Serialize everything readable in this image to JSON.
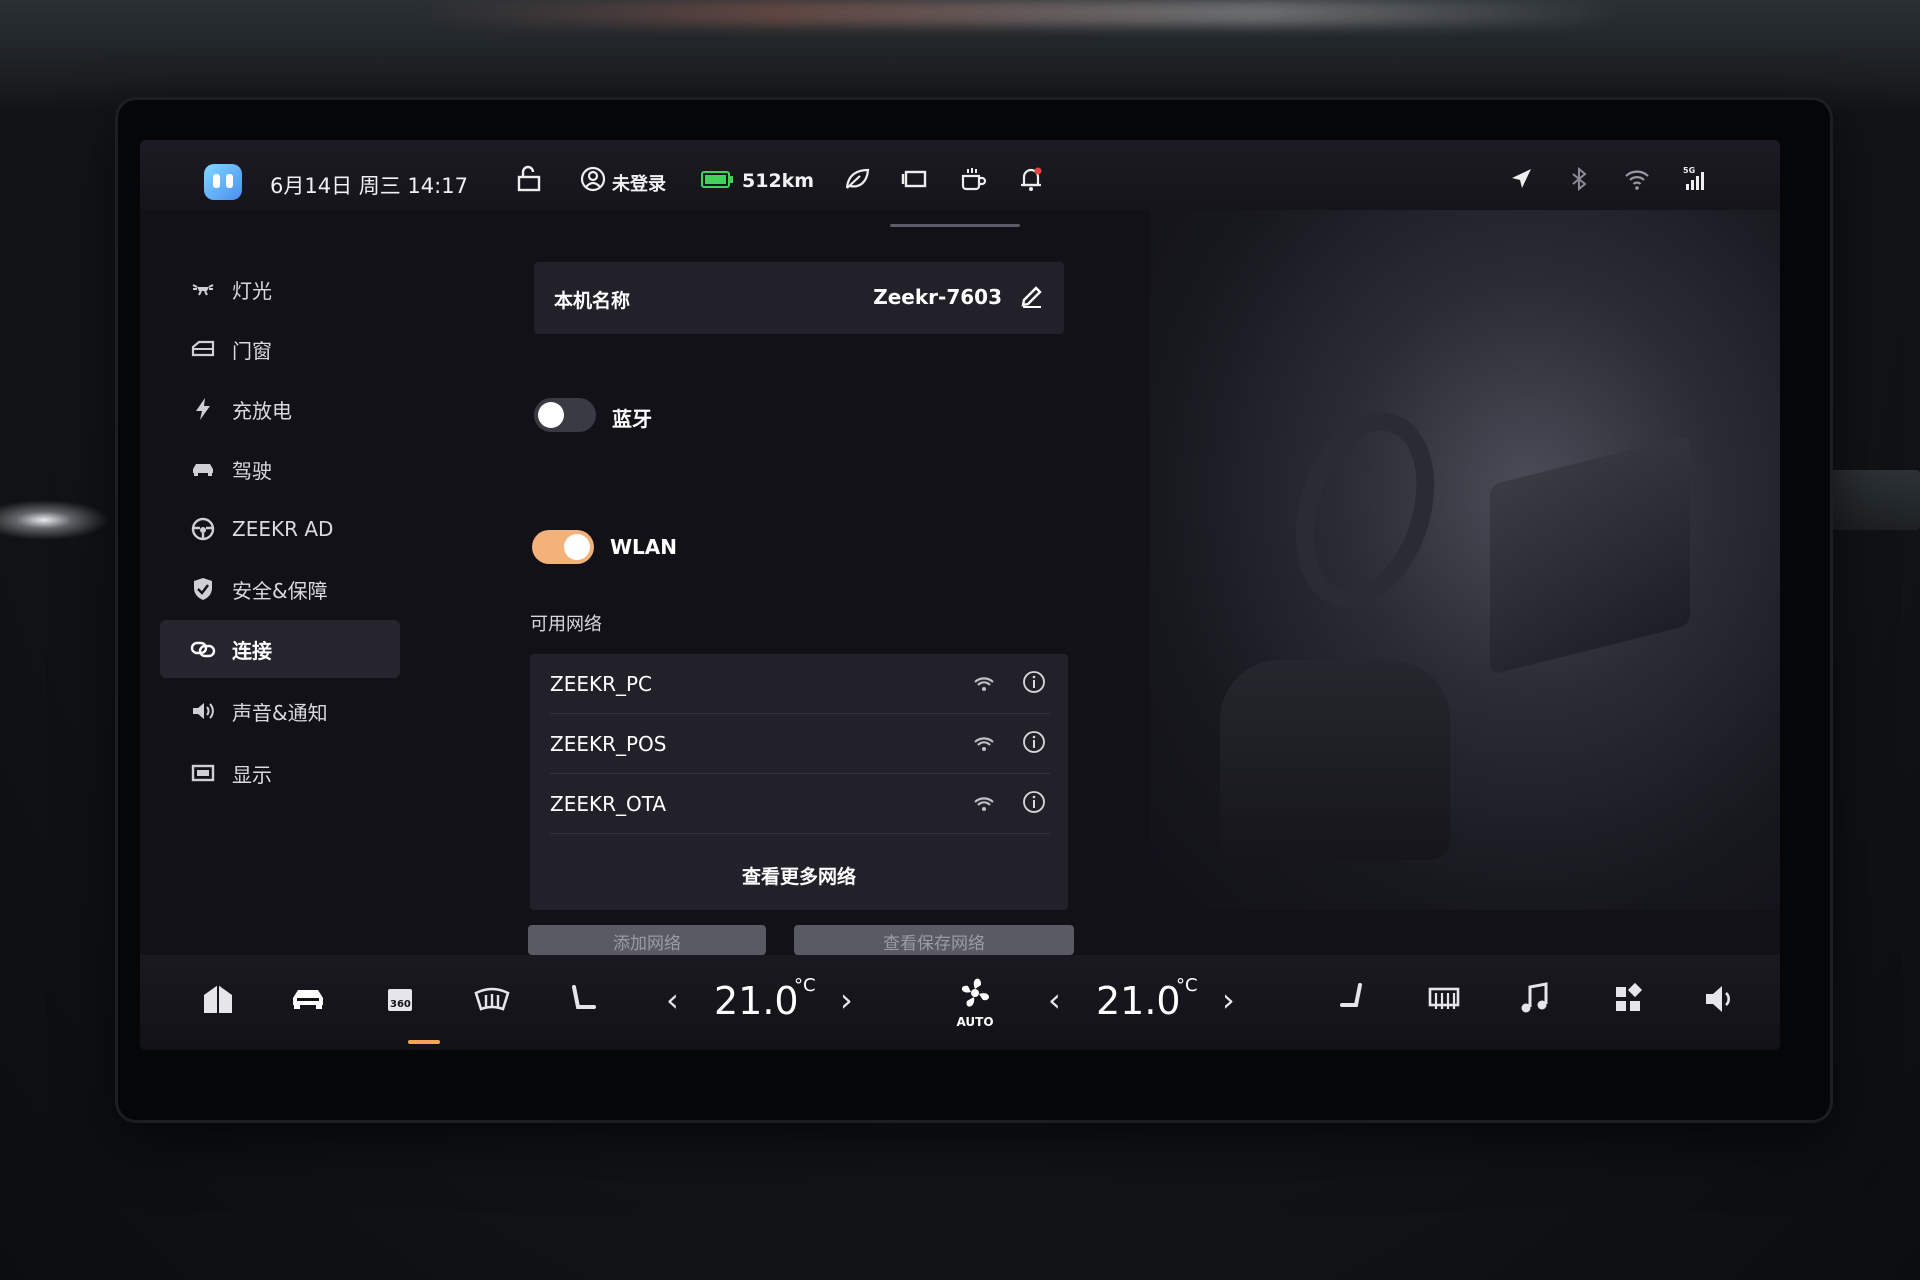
{
  "statusbar": {
    "datetime": "6月14日 周三 14:17",
    "login_status": "未登录",
    "range": "512km"
  },
  "sidebar": {
    "items": [
      {
        "label": "灯光",
        "icon": "headlight-icon"
      },
      {
        "label": "门窗",
        "icon": "door-window-icon"
      },
      {
        "label": "充放电",
        "icon": "lightning-icon"
      },
      {
        "label": "驾驶",
        "icon": "car-icon"
      },
      {
        "label": "ZEEKR AD",
        "icon": "steering-wheel-icon"
      },
      {
        "label": "安全&保障",
        "icon": "shield-icon"
      },
      {
        "label": "连接",
        "icon": "link-icon",
        "active": true
      },
      {
        "label": "声音&通知",
        "icon": "speaker-icon"
      },
      {
        "label": "显示",
        "icon": "display-icon"
      }
    ]
  },
  "device": {
    "label": "本机名称",
    "name": "Zeekr-7603"
  },
  "bluetooth": {
    "label": "蓝牙",
    "enabled": false
  },
  "wlan": {
    "label": "WLAN",
    "enabled": true
  },
  "networks": {
    "title": "可用网络",
    "items": [
      {
        "ssid": "ZEEKR_PC"
      },
      {
        "ssid": "ZEEKR_POS"
      },
      {
        "ssid": "ZEEKR_OTA"
      }
    ],
    "more_label": "查看更多网络",
    "add_label": "添加网络",
    "saved_label": "查看保存网络"
  },
  "climate": {
    "left_temp": "21.0",
    "right_temp": "21.0",
    "unit": "°C",
    "fan_mode": "AUTO"
  },
  "colors": {
    "accent": "#f2b27a",
    "indicator": "#f2a35a",
    "background": "#121118",
    "panel": "#22212a"
  }
}
